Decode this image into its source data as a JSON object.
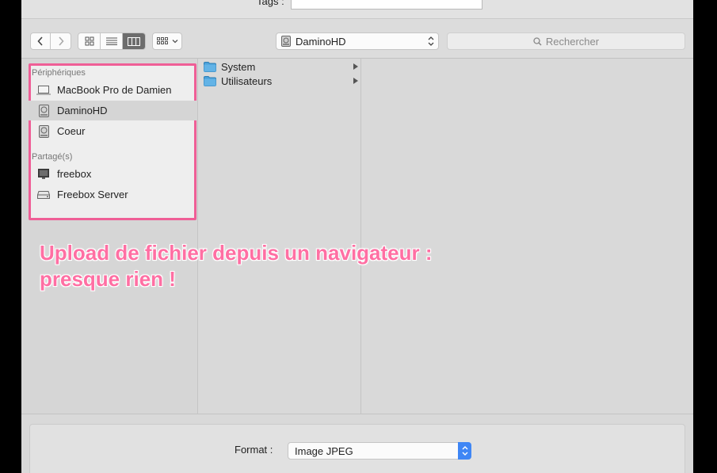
{
  "header": {
    "tags_label": "Tags :",
    "tags_value": ""
  },
  "toolbar": {
    "back_icon": "chevron-left-icon",
    "forward_icon": "chevron-right-icon",
    "view_modes": [
      "icon-view-icon",
      "list-view-icon",
      "column-view-icon"
    ],
    "active_view": "column",
    "arrange_icon": "arrange-grid-icon",
    "location": "DaminoHD",
    "search_placeholder": "Rechercher"
  },
  "sidebar": {
    "sections": [
      {
        "title": "Périphériques",
        "items": [
          {
            "label": "MacBook Pro de Damien",
            "icon": "laptop-icon",
            "selected": false
          },
          {
            "label": "DaminoHD",
            "icon": "hard-drive-icon",
            "selected": true
          },
          {
            "label": "Coeur",
            "icon": "hard-drive-icon",
            "selected": false
          }
        ]
      },
      {
        "title": "Partagé(s)",
        "items": [
          {
            "label": "freebox",
            "icon": "monitor-icon",
            "selected": false
          },
          {
            "label": "Freebox Server",
            "icon": "server-icon",
            "selected": false
          }
        ]
      }
    ]
  },
  "columns": {
    "first": [
      {
        "label": "System",
        "icon": "folder-icon",
        "has_children": true
      },
      {
        "label": "Utilisateurs",
        "icon": "folder-icon",
        "has_children": true
      }
    ]
  },
  "annotation": {
    "line1": "Upload de fichier depuis un navigateur :",
    "line2": "presque rien !",
    "color": "#ff6fa3"
  },
  "format": {
    "label": "Format :",
    "value": "Image JPEG"
  },
  "colors": {
    "accent": "#3f86f5",
    "highlight_border": "#ef5e96"
  }
}
